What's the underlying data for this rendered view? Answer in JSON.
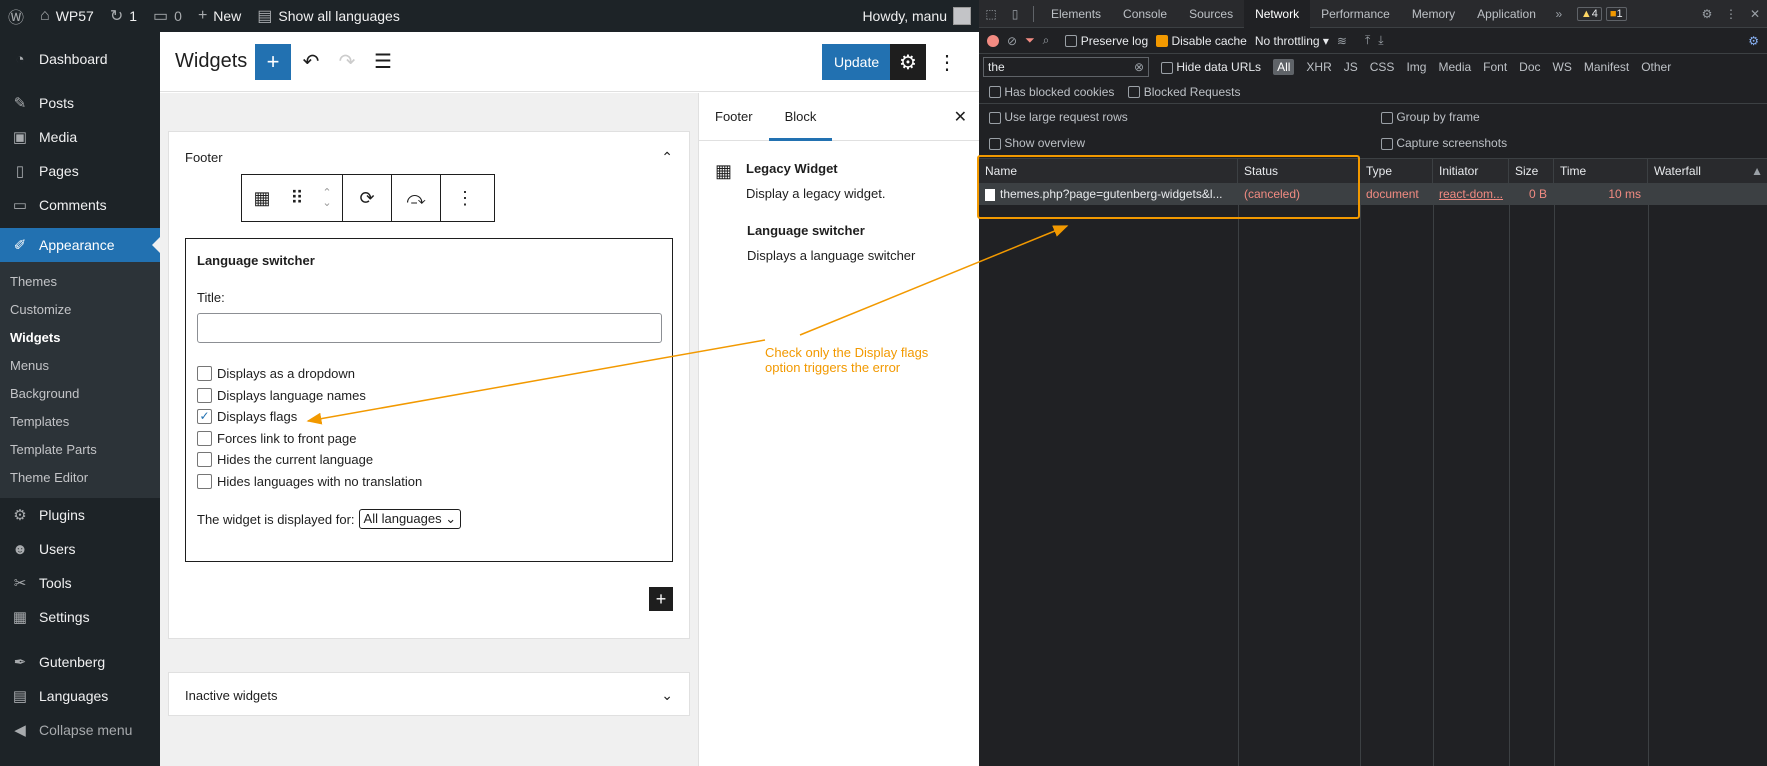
{
  "adminbar": {
    "site": "WP57",
    "updates": "1",
    "comments": "0",
    "new": "New",
    "languages": "Show all languages",
    "howdy": "Howdy, manu"
  },
  "sidebar": {
    "items": [
      {
        "label": "Dashboard",
        "icon": "dashboard-icon"
      },
      {
        "label": "Posts",
        "icon": "pin-icon"
      },
      {
        "label": "Media",
        "icon": "media-icon"
      },
      {
        "label": "Pages",
        "icon": "page-icon"
      },
      {
        "label": "Comments",
        "icon": "comment-icon"
      },
      {
        "label": "Appearance",
        "icon": "brush-icon"
      },
      {
        "label": "Plugins",
        "icon": "plugin-icon"
      },
      {
        "label": "Users",
        "icon": "users-icon"
      },
      {
        "label": "Tools",
        "icon": "wrench-icon"
      },
      {
        "label": "Settings",
        "icon": "settings-icon"
      },
      {
        "label": "Gutenberg",
        "icon": "pen-icon"
      },
      {
        "label": "Languages",
        "icon": "translate-icon"
      },
      {
        "label": "Collapse menu",
        "icon": "collapse-icon"
      }
    ],
    "submenu": [
      "Themes",
      "Customize",
      "Widgets",
      "Menus",
      "Background",
      "Templates",
      "Template Parts",
      "Theme Editor"
    ]
  },
  "editor": {
    "title": "Widgets",
    "update": "Update",
    "footer_area": "Footer",
    "inactive_area": "Inactive widgets",
    "widget": {
      "title": "Language switcher",
      "title_label": "Title:",
      "title_value": "",
      "options": [
        {
          "label": "Displays as a dropdown",
          "checked": false
        },
        {
          "label": "Displays language names",
          "checked": false
        },
        {
          "label": "Displays flags",
          "checked": true
        },
        {
          "label": "Forces link to front page",
          "checked": false
        },
        {
          "label": "Hides the current language",
          "checked": false
        },
        {
          "label": "Hides languages with no translation",
          "checked": false
        }
      ],
      "displayed_for_label": "The widget is displayed for:",
      "displayed_for_value": "All languages"
    }
  },
  "panel": {
    "tabs": [
      "Footer",
      "Block"
    ],
    "block_name": "Legacy Widget",
    "block_desc": "Display a legacy widget.",
    "widget_name": "Language switcher",
    "widget_desc": "Displays a language switcher"
  },
  "devtools": {
    "tabs": [
      "Elements",
      "Console",
      "Sources",
      "Network",
      "Performance",
      "Memory",
      "Application"
    ],
    "warnings": "4",
    "issues": "1",
    "preserve_log": "Preserve log",
    "disable_cache": "Disable cache",
    "throttling": "No throttling",
    "filter_value": "the",
    "hide_data_urls": "Hide data URLs",
    "types": [
      "All",
      "XHR",
      "JS",
      "CSS",
      "Img",
      "Media",
      "Font",
      "Doc",
      "WS",
      "Manifest",
      "Other"
    ],
    "has_blocked_cookies": "Has blocked cookies",
    "blocked_requests": "Blocked Requests",
    "large_rows": "Use large request rows",
    "group_by_frame": "Group by frame",
    "show_overview": "Show overview",
    "capture_screenshots": "Capture screenshots",
    "columns": [
      "Name",
      "Status",
      "Type",
      "Initiator",
      "Size",
      "Time",
      "Waterfall"
    ],
    "rows": [
      {
        "name": "themes.php?page=gutenberg-widgets&l...",
        "status": "(canceled)",
        "type": "document",
        "initiator": "react-dom...",
        "size": "0 B",
        "time": "10 ms"
      }
    ]
  },
  "annotation": "Check only the Display flags option triggers the error",
  "colors": {
    "accent": "#2271b1",
    "annotation": "#f29900",
    "error": "#f28b82"
  }
}
